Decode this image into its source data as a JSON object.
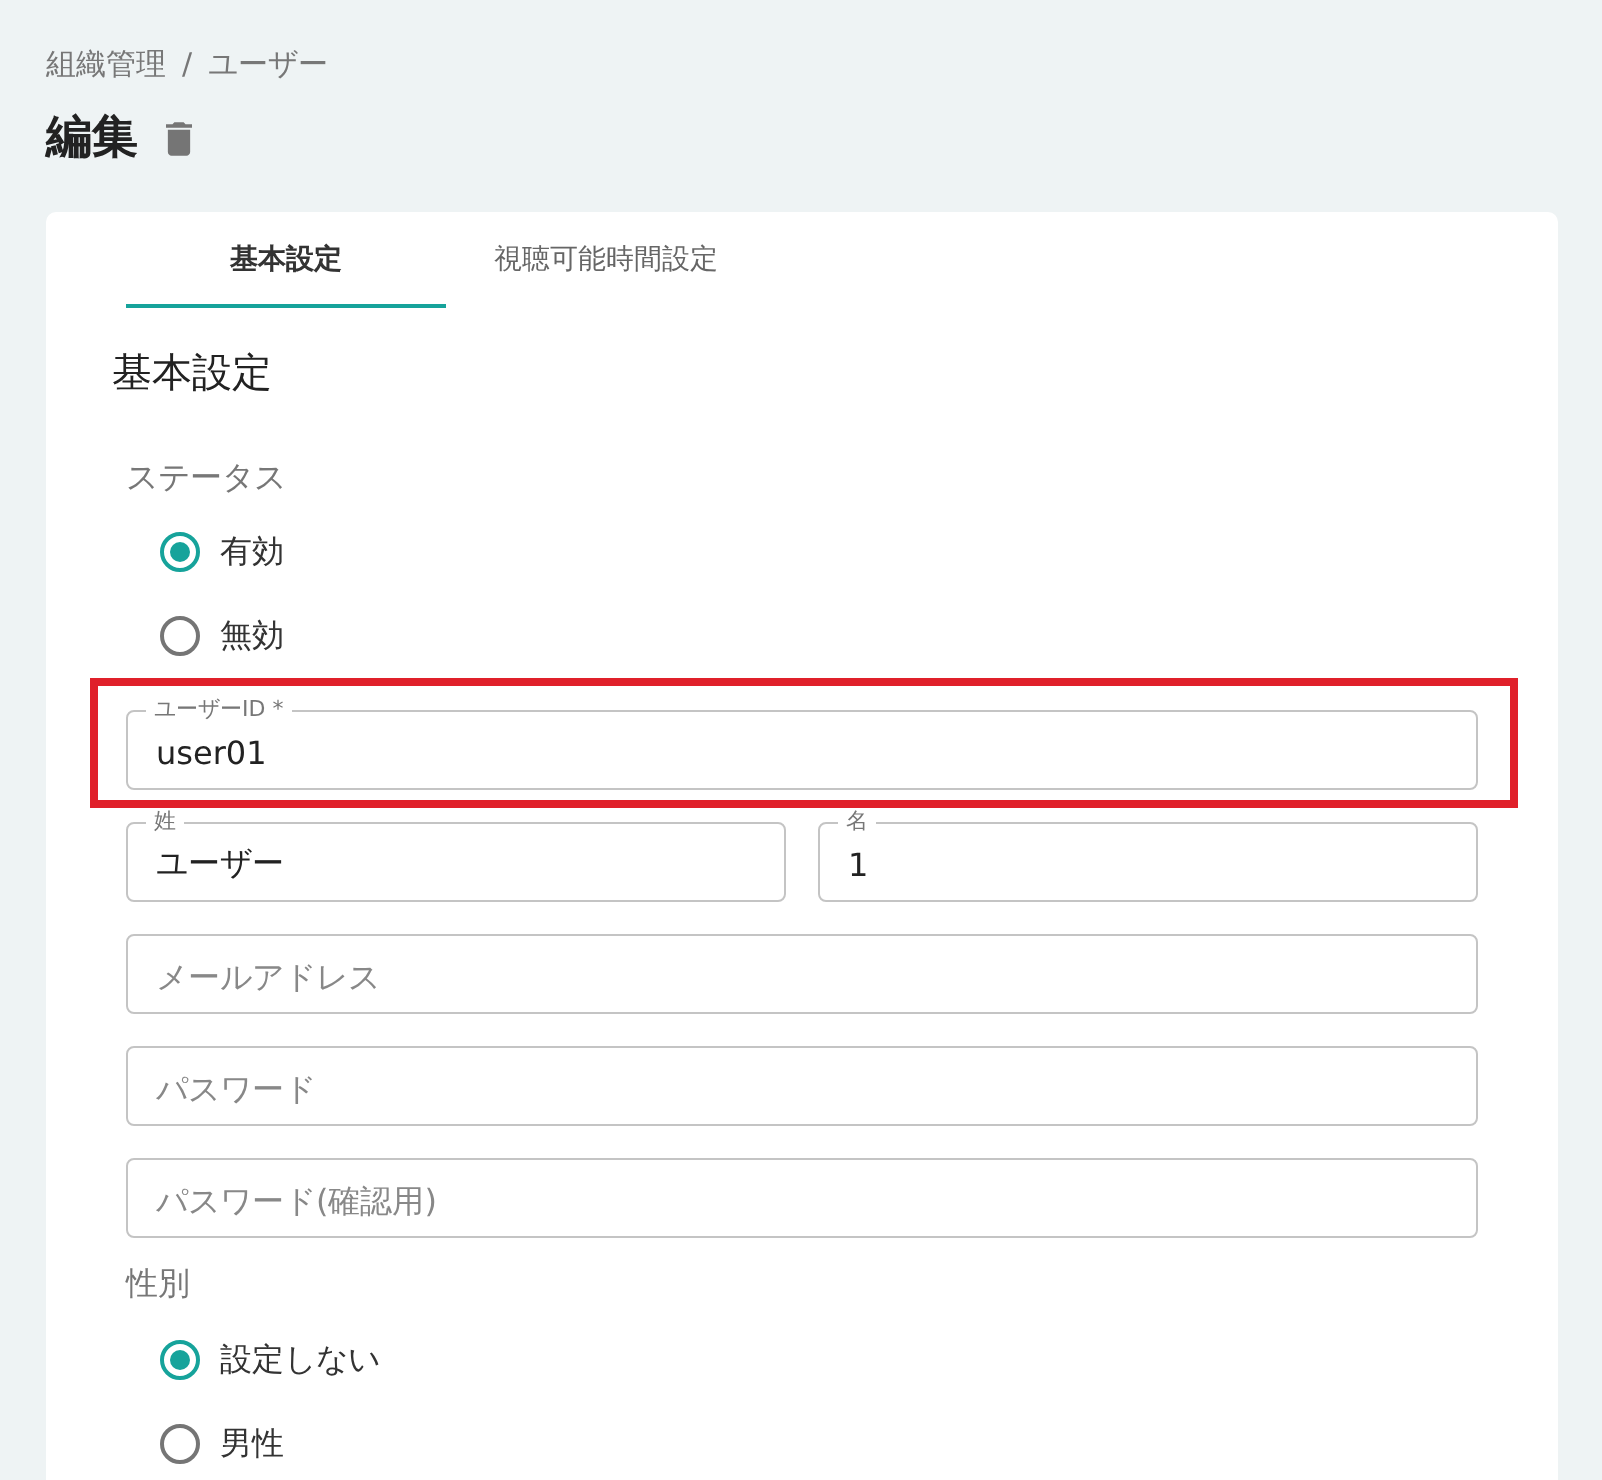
{
  "breadcrumb": {
    "separator": "/",
    "items": [
      {
        "label": "組織管理"
      },
      {
        "label": "ユーザー"
      }
    ]
  },
  "page_title": "編集",
  "tabs": [
    {
      "label": "基本設定",
      "selected": true
    },
    {
      "label": "視聴可能時間設定",
      "selected": false
    }
  ],
  "section_title": "基本設定",
  "form": [
    {
      "kind": "radio_group",
      "label": "ステータス",
      "options": [
        {
          "label": "有効",
          "selected": true
        },
        {
          "label": "無効",
          "selected": false
        }
      ]
    },
    {
      "kind": "field",
      "label": "ユーザーID *",
      "value": "user01",
      "highlighted": true
    },
    {
      "kind": "row",
      "fields": [
        {
          "label": "姓",
          "value": "ユーザー"
        },
        {
          "label": "名",
          "value": "1"
        }
      ]
    },
    {
      "kind": "field",
      "placeholder": "メールアドレス",
      "highlighted": false
    },
    {
      "kind": "field",
      "placeholder": "パスワード",
      "highlighted": false
    },
    {
      "kind": "field",
      "placeholder": "パスワード(確認用)",
      "highlighted": false
    },
    {
      "kind": "radio_group",
      "label": "性別",
      "options": [
        {
          "label": "設定しない",
          "selected": true
        },
        {
          "label": "男性",
          "selected": false
        }
      ]
    }
  ]
}
